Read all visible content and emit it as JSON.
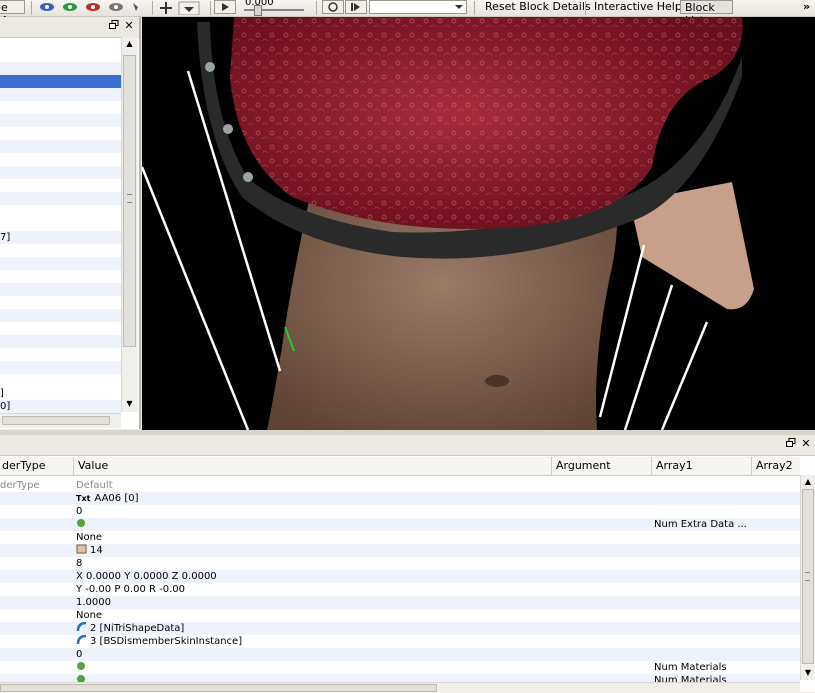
{
  "toolbar": {
    "save_as_label": "e As",
    "time_value": "0.000",
    "reset_block_details": "Reset Block Details",
    "interactive_help": "Interactive Help",
    "block_list": "Block List",
    "overflow": "»"
  },
  "left_panel": {
    "rows": [
      "",
      "",
      "",
      "",
      "",
      "",
      "",
      "",
      "",
      "",
      "",
      "",
      "",
      "7]",
      "",
      "",
      "",
      "",
      "",
      "",
      "",
      "",
      "",
      "",
      "]",
      "0]"
    ],
    "selected_index": 2
  },
  "bottom_panel": {
    "columns": [
      "derType",
      "Value",
      "Argument",
      "Array1",
      "Array2"
    ],
    "rows": [
      {
        "type": "derType",
        "value": "Default",
        "array1": "",
        "icon": ""
      },
      {
        "type": "",
        "value": "AA06 [0]",
        "array1": "",
        "icon": "txt-icon"
      },
      {
        "type": "",
        "value": "0",
        "array1": "",
        "icon": ""
      },
      {
        "type": "",
        "value": "",
        "array1": "Num Extra Data ...",
        "icon": "recycle-icon"
      },
      {
        "type": "",
        "value": "None",
        "array1": "",
        "icon": ""
      },
      {
        "type": "",
        "value": "14",
        "array1": "",
        "icon": "flag-icon"
      },
      {
        "type": "",
        "value": "8",
        "array1": "",
        "icon": ""
      },
      {
        "type": "",
        "value": "X 0.0000 Y 0.0000 Z 0.0000",
        "array1": "",
        "icon": ""
      },
      {
        "type": "",
        "value": "Y -0.00 P 0.00 R -0.00",
        "array1": "",
        "icon": ""
      },
      {
        "type": "",
        "value": "1.0000",
        "array1": "",
        "icon": ""
      },
      {
        "type": "",
        "value": "None",
        "array1": "",
        "icon": ""
      },
      {
        "type": "",
        "value": "2 [NiTriShapeData]",
        "array1": "",
        "icon": "link-icon"
      },
      {
        "type": "",
        "value": "3 [BSDismemberSkinInstance]",
        "array1": "",
        "icon": "link-icon"
      },
      {
        "type": "",
        "value": "0",
        "array1": "",
        "icon": ""
      },
      {
        "type": "",
        "value": "",
        "array1": "Num Materials",
        "icon": "recycle-icon"
      },
      {
        "type": "",
        "value": "",
        "array1": "Num Materials",
        "icon": "recycle-icon"
      }
    ]
  },
  "colors": {
    "selection": "#3a6fd0",
    "alt_row": "#eef3fb",
    "garment_red": "#8c1a2c",
    "skin": "#8a6a58",
    "wire": "#ffffff",
    "axis_green": "#22cc22"
  }
}
